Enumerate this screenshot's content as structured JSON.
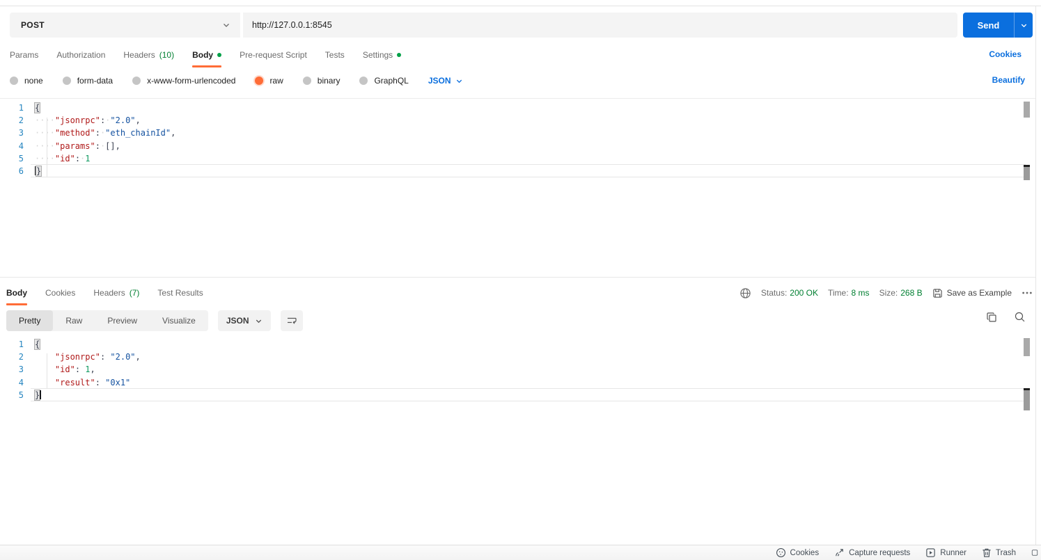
{
  "request": {
    "method": "POST",
    "url": "http://127.0.0.1:8545",
    "send_label": "Send",
    "tabs": [
      {
        "label": "Params"
      },
      {
        "label": "Authorization"
      },
      {
        "label": "Headers",
        "count": "(10)"
      },
      {
        "label": "Body",
        "active": true,
        "dot": true
      },
      {
        "label": "Pre-request Script"
      },
      {
        "label": "Tests"
      },
      {
        "label": "Settings",
        "dot": true
      }
    ],
    "cookies_link": "Cookies",
    "body_types": [
      {
        "label": "none"
      },
      {
        "label": "form-data"
      },
      {
        "label": "x-www-form-urlencoded"
      },
      {
        "label": "raw",
        "selected": true
      },
      {
        "label": "binary"
      },
      {
        "label": "GraphQL"
      }
    ],
    "raw_language": "JSON",
    "beautify_link": "Beautify",
    "editor": {
      "active_line": 6,
      "lines": [
        [
          [
            "bh",
            "{"
          ]
        ],
        [
          [
            "ws",
            "····"
          ],
          [
            "k",
            "\"jsonrpc\""
          ],
          [
            "p",
            ":"
          ],
          [
            "ws",
            "·"
          ],
          [
            "s",
            "\"2.0\""
          ],
          [
            "p",
            ","
          ]
        ],
        [
          [
            "ws",
            "····"
          ],
          [
            "k",
            "\"method\""
          ],
          [
            "p",
            ":"
          ],
          [
            "ws",
            "·"
          ],
          [
            "s",
            "\"eth_chainId\""
          ],
          [
            "p",
            ","
          ]
        ],
        [
          [
            "ws",
            "····"
          ],
          [
            "k",
            "\"params\""
          ],
          [
            "p",
            ":"
          ],
          [
            "ws",
            "·"
          ],
          [
            "p",
            "[],"
          ]
        ],
        [
          [
            "ws",
            "····"
          ],
          [
            "k",
            "\"id\""
          ],
          [
            "p",
            ":"
          ],
          [
            "ws",
            "·"
          ],
          [
            "n",
            "1"
          ]
        ],
        [
          [
            "cur",
            ""
          ],
          [
            "bh",
            "}"
          ]
        ]
      ]
    }
  },
  "response": {
    "tabs": [
      {
        "label": "Body",
        "active": true
      },
      {
        "label": "Cookies"
      },
      {
        "label": "Headers",
        "count": "(7)"
      },
      {
        "label": "Test Results"
      }
    ],
    "meta": {
      "status_label": "Status:",
      "status_value": "200 OK",
      "time_label": "Time:",
      "time_value": "8 ms",
      "size_label": "Size:",
      "size_value": "268 B",
      "save_as_example": "Save as Example"
    },
    "view_modes": [
      {
        "label": "Pretty",
        "active": true
      },
      {
        "label": "Raw"
      },
      {
        "label": "Preview"
      },
      {
        "label": "Visualize"
      }
    ],
    "language": "JSON",
    "editor": {
      "active_line": 5,
      "lines": [
        [
          [
            "bh",
            "{"
          ]
        ],
        [
          [
            "sp",
            "    "
          ],
          [
            "k",
            "\"jsonrpc\""
          ],
          [
            "p",
            ": "
          ],
          [
            "s",
            "\"2.0\""
          ],
          [
            "p",
            ","
          ]
        ],
        [
          [
            "sp",
            "    "
          ],
          [
            "k",
            "\"id\""
          ],
          [
            "p",
            ": "
          ],
          [
            "n",
            "1"
          ],
          [
            "p",
            ","
          ]
        ],
        [
          [
            "sp",
            "    "
          ],
          [
            "k",
            "\"result\""
          ],
          [
            "p",
            ": "
          ],
          [
            "s",
            "\"0x1\""
          ]
        ],
        [
          [
            "bh",
            "}"
          ],
          [
            "cur",
            ""
          ]
        ]
      ]
    }
  },
  "statusbar": {
    "cookies": "Cookies",
    "capture_requests": "Capture requests",
    "runner": "Runner",
    "trash": "Trash"
  },
  "colors": {
    "accent_orange": "#FF6C37",
    "accent_blue": "#0B6FDE",
    "success_green": "#007F31"
  }
}
